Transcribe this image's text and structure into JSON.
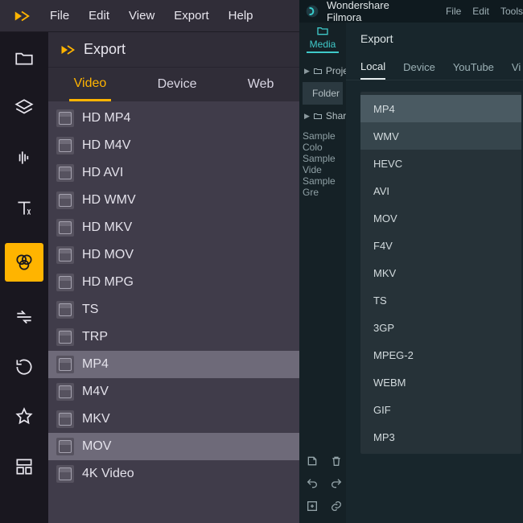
{
  "left_app": {
    "menu": [
      "File",
      "Edit",
      "View",
      "Export",
      "Help"
    ],
    "panel_title": "Export",
    "tabs": [
      {
        "label": "Video",
        "active": true
      },
      {
        "label": "Device",
        "active": false
      },
      {
        "label": "Web",
        "active": false
      }
    ],
    "formats": [
      {
        "label": "HD MP4",
        "selected": false
      },
      {
        "label": "HD M4V",
        "selected": false
      },
      {
        "label": "HD AVI",
        "selected": false
      },
      {
        "label": "HD WMV",
        "selected": false
      },
      {
        "label": "HD MKV",
        "selected": false
      },
      {
        "label": "HD MOV",
        "selected": false
      },
      {
        "label": "HD MPG",
        "selected": false
      },
      {
        "label": "TS",
        "selected": false
      },
      {
        "label": "TRP",
        "selected": false
      },
      {
        "label": "MP4",
        "selected": true
      },
      {
        "label": "M4V",
        "selected": false
      },
      {
        "label": "MKV",
        "selected": false
      },
      {
        "label": "MOV",
        "selected": true
      },
      {
        "label": "4K Video",
        "selected": false
      }
    ],
    "sidebar_icons": [
      {
        "name": "folder-icon",
        "active": false
      },
      {
        "name": "layers-icon",
        "active": false
      },
      {
        "name": "audio-wave-icon",
        "active": false
      },
      {
        "name": "text-icon",
        "active": false
      },
      {
        "name": "effects-icon",
        "active": true
      },
      {
        "name": "transition-icon",
        "active": false
      },
      {
        "name": "rotate-icon",
        "active": false
      },
      {
        "name": "star-icon",
        "active": false
      },
      {
        "name": "template-icon",
        "active": false
      }
    ],
    "accent_color": "#ffb400"
  },
  "right_app": {
    "title": "Wondershare Filmora",
    "menu": [
      "File",
      "Edit",
      "Tools"
    ],
    "media_label": "Media",
    "tree": [
      {
        "label": "Proje",
        "icon": "folder",
        "selected": false,
        "expandable": true
      },
      {
        "label": "Folder",
        "icon": "none",
        "selected": true,
        "expandable": false
      },
      {
        "label": "Share",
        "icon": "folder",
        "selected": false,
        "expandable": true
      }
    ],
    "samples": [
      "Sample Colo",
      "Sample Vide",
      "Sample Gre"
    ],
    "export_title": "Export",
    "export_tabs": [
      {
        "label": "Local",
        "active": true
      },
      {
        "label": "Device",
        "active": false
      },
      {
        "label": "YouTube",
        "active": false
      },
      {
        "label": "Vi",
        "active": false
      }
    ],
    "export_formats": [
      {
        "label": "MP4",
        "state": "sel"
      },
      {
        "label": "WMV",
        "state": "hover"
      },
      {
        "label": "HEVC",
        "state": ""
      },
      {
        "label": "AVI",
        "state": ""
      },
      {
        "label": "MOV",
        "state": ""
      },
      {
        "label": "F4V",
        "state": ""
      },
      {
        "label": "MKV",
        "state": ""
      },
      {
        "label": "TS",
        "state": ""
      },
      {
        "label": "3GP",
        "state": ""
      },
      {
        "label": "MPEG-2",
        "state": ""
      },
      {
        "label": "WEBM",
        "state": ""
      },
      {
        "label": "GIF",
        "state": ""
      },
      {
        "label": "MP3",
        "state": ""
      }
    ],
    "bottom_icons": [
      [
        "export-icon",
        "trash-icon"
      ],
      [
        "undo-icon",
        "redo-icon"
      ],
      [
        "add-icon",
        "link-icon"
      ]
    ],
    "accent_color": "#3fc9c9"
  }
}
